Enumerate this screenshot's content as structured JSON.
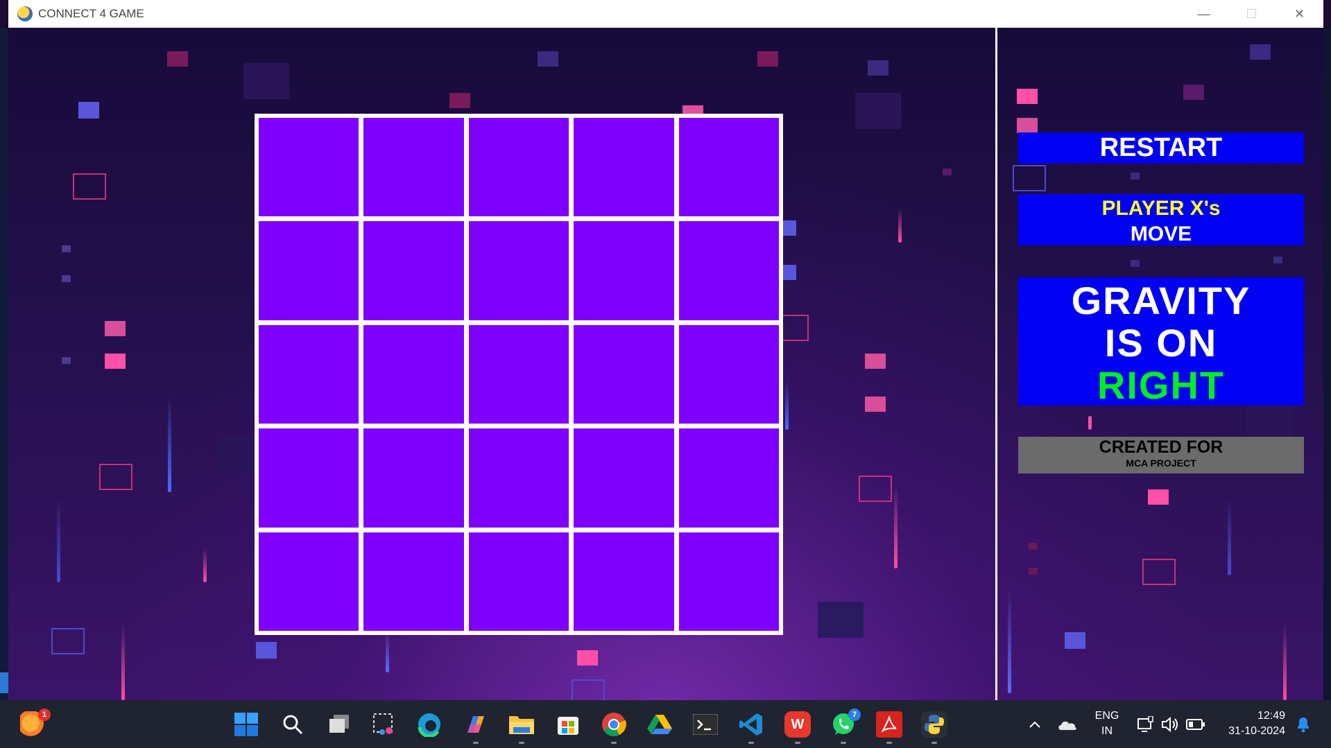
{
  "window": {
    "title": "CONNECT 4 GAME",
    "controls": [
      "minimize",
      "maximize",
      "close"
    ]
  },
  "board": {
    "rows": 5,
    "cols": 5,
    "cell_color": "#7f00ff",
    "cells": [
      "",
      "",
      "",
      "",
      "",
      "",
      "",
      "",
      "",
      "",
      "",
      "",
      "",
      "",
      "",
      "",
      "",
      "",
      "",
      "",
      "",
      "",
      "",
      "",
      ""
    ]
  },
  "panel": {
    "restart_label": "RESTART",
    "turn_line1": "PLAYER X's",
    "turn_line2": "MOVE",
    "gravity_line1": "GRAVITY",
    "gravity_line2": "IS ON",
    "gravity_direction": "RIGHT",
    "credit_title": "CREATED FOR",
    "credit_subtitle": "MCA PROJECT"
  },
  "colors": {
    "button_blue": "#0000f2",
    "player_yellow": "#ffff33",
    "direction_green": "#00ee22",
    "credit_gray": "#6b6b6b",
    "cell_purple": "#7f00ff"
  },
  "taskbar": {
    "apps": [
      {
        "name": "weather-icon",
        "badge": "1"
      },
      {
        "name": "start-icon"
      },
      {
        "name": "search-icon"
      },
      {
        "name": "task-view-icon"
      },
      {
        "name": "snipping-tool-icon"
      },
      {
        "name": "edge-icon"
      },
      {
        "name": "copilot-icon"
      },
      {
        "name": "file-explorer-icon"
      },
      {
        "name": "microsoft-store-icon"
      },
      {
        "name": "chrome-icon"
      },
      {
        "name": "google-drive-icon"
      },
      {
        "name": "terminal-icon"
      },
      {
        "name": "vscode-icon"
      },
      {
        "name": "wps-office-icon"
      },
      {
        "name": "whatsapp-icon",
        "badge": "7"
      },
      {
        "name": "acrobat-icon"
      },
      {
        "name": "python-icon"
      }
    ],
    "tray": {
      "language_line1": "ENG",
      "language_line2": "IN",
      "time": "12:49",
      "date": "31-10-2024"
    }
  }
}
